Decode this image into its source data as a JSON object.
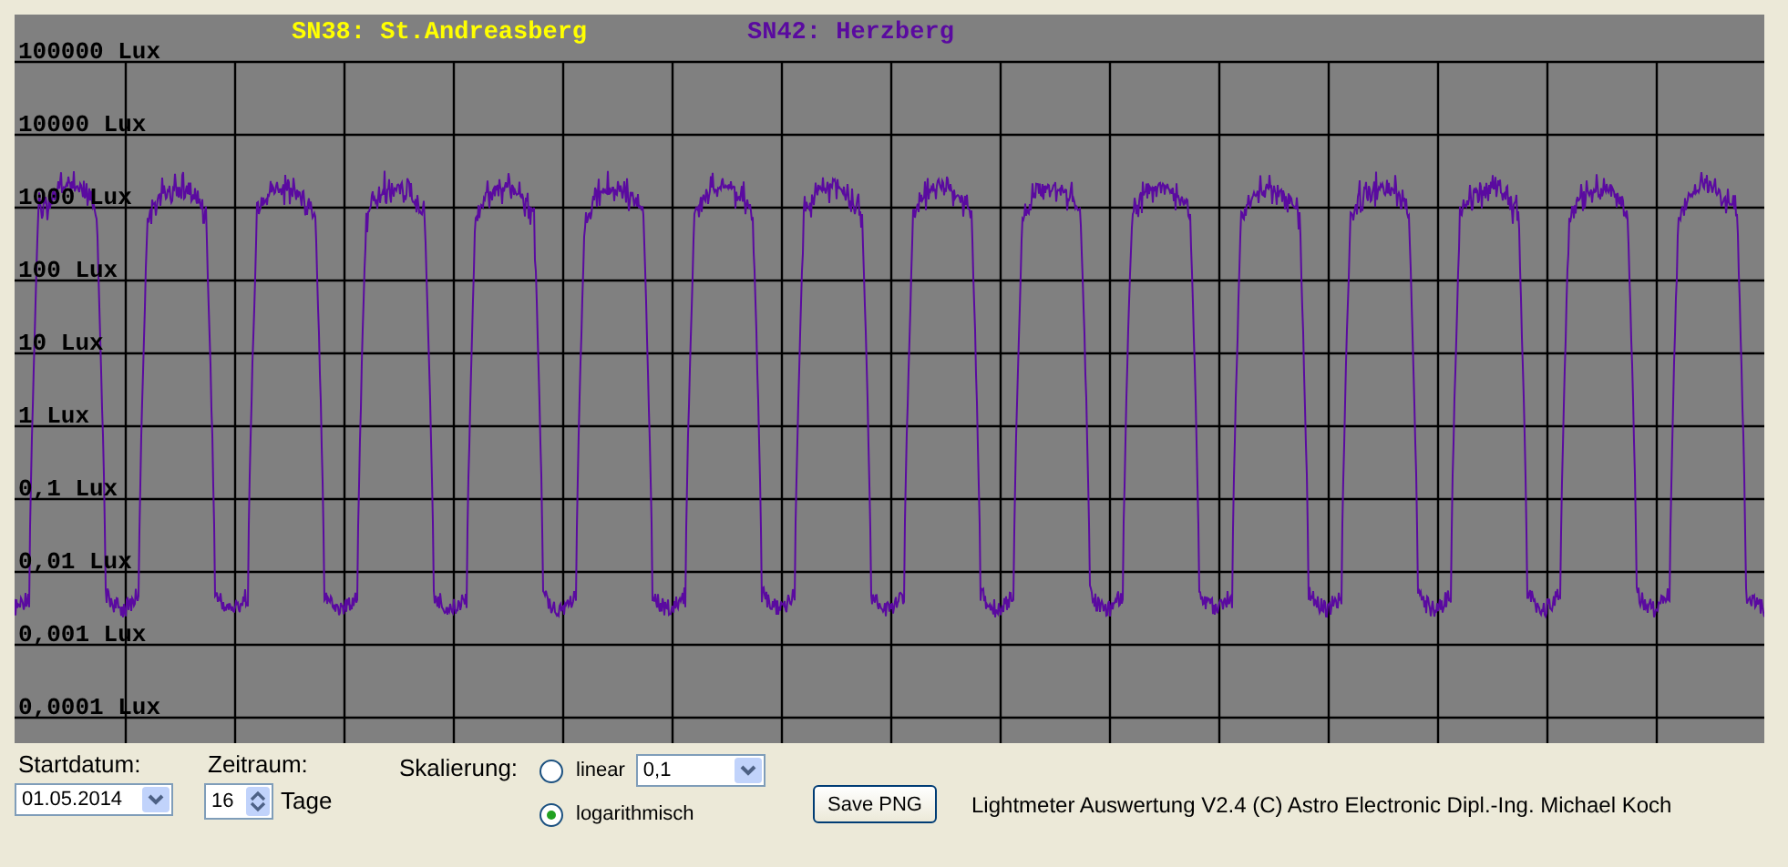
{
  "plot": {
    "legend": [
      {
        "label": "SN38: St.Andreasberg",
        "color": "#ffff00"
      },
      {
        "label": "SN42: Herzberg",
        "color": "#5a0aa0"
      }
    ],
    "axis_labels": [
      "100000 Lux",
      "10000 Lux",
      "1000 Lux",
      "100 Lux",
      "10 Lux",
      "1 Lux",
      "0,1 Lux",
      "0,01 Lux",
      "0,001 Lux",
      "0,0001 Lux"
    ]
  },
  "controls": {
    "start_date": {
      "label": "Startdatum:",
      "value": "01.05.2014"
    },
    "period": {
      "label": "Zeitraum:",
      "value": "16",
      "unit": "Tage"
    },
    "scaling": {
      "label": "Skalierung:",
      "options": [
        {
          "label": "linear",
          "selected": false
        },
        {
          "label": "logarithmisch",
          "selected": true
        }
      ],
      "linear_value": "0,1"
    },
    "save_button": "Save PNG",
    "credits": "Lightmeter Auswertung V2.4  (C) Astro Electronic Dipl.-Ing. Michael Koch"
  }
}
